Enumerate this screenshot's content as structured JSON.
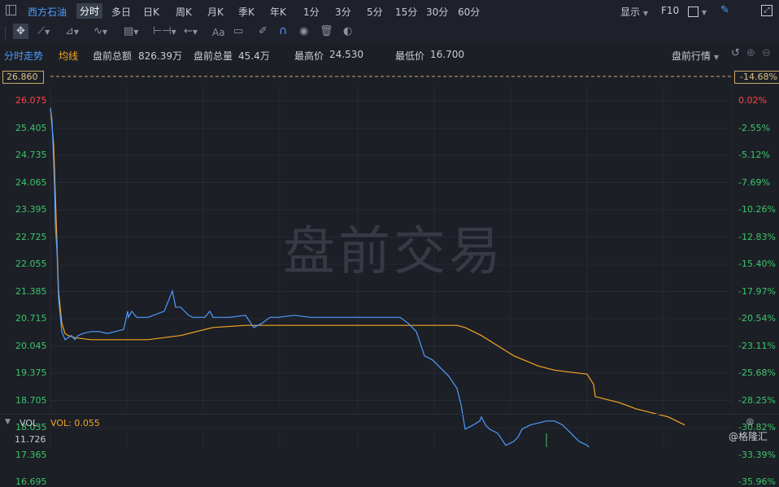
{
  "topbar": {
    "stock_name": "西方石油",
    "timeframes": [
      "分时",
      "多日",
      "日K",
      "周K",
      "月K",
      "季K",
      "年K",
      "1分",
      "3分",
      "5分",
      "15分",
      "30分",
      "60分"
    ],
    "active_timeframe": "分时",
    "display_label": "显示",
    "f10_label": "F10"
  },
  "toolbar": {
    "font_label": "Aa"
  },
  "info": {
    "mode_label": "分时走势",
    "avg_label": "均线",
    "amount_label": "盘前总额",
    "amount_value": "826.39万",
    "volume_label": "盘前总量",
    "volume_value": "45.4万",
    "high_label": "最高价",
    "high_value": "24.530",
    "low_label": "最低价",
    "low_value": "16.700",
    "session_label": "盘前行情"
  },
  "price_axis": {
    "top_price": "26.860",
    "top_pct": "-14.68%",
    "prices": [
      "26.075",
      "25.405",
      "24.735",
      "24.065",
      "23.395",
      "22.725",
      "22.055",
      "21.385",
      "20.715",
      "20.045",
      "19.375",
      "18.705",
      "18.035",
      "17.365",
      "16.695"
    ],
    "pcts": [
      "0.02%",
      "-2.55%",
      "-5.12%",
      "-7.69%",
      "-10.26%",
      "-12.83%",
      "-15.40%",
      "-17.97%",
      "-20.54%",
      "-23.11%",
      "-25.68%",
      "-28.25%",
      "-30.82%",
      "-33.39%",
      "-35.96%"
    ]
  },
  "watermark": "盘前交易",
  "volume": {
    "label": "VOL",
    "value_text": "VOL: 0.055",
    "axis_top": "11.726"
  },
  "brand": "@格隆汇",
  "colors": {
    "price_line": "#4d9cff",
    "avg_line": "#f5a623",
    "up": "#ff4545",
    "down": "#3bc66a",
    "accent": "#4d9cff"
  },
  "chart_data": {
    "type": "line",
    "ylim": [
      16.695,
      26.075
    ],
    "series": [
      {
        "name": "分时走势",
        "x": [
          0,
          2,
          4,
          5,
          6,
          8,
          10,
          14,
          18,
          22,
          26,
          30,
          34,
          40,
          50,
          60,
          70,
          80,
          90,
          95,
          96,
          100,
          106,
          110,
          120,
          140,
          150,
          154,
          160,
          170,
          175,
          180,
          190,
          196,
          200,
          220,
          240,
          250,
          260,
          270,
          280,
          300,
          320,
          340,
          360,
          380,
          400,
          420,
          430,
          440,
          450,
          460,
          470,
          480,
          490,
          500,
          505,
          510,
          520,
          528,
          530,
          535,
          540,
          550,
          560,
          570,
          575,
          580,
          590,
          600,
          610,
          620,
          630,
          640,
          650,
          660,
          670,
          680,
          690,
          700,
          710,
          715,
          720,
          730,
          740,
          750,
          760,
          766
        ],
        "y": [
          25.9,
          25.6,
          24.5,
          24.0,
          23.0,
          22.4,
          21.2,
          20.4,
          20.2,
          20.25,
          20.3,
          20.2,
          20.3,
          20.35,
          20.4,
          20.4,
          20.35,
          20.4,
          20.45,
          20.9,
          20.75,
          20.9,
          20.75,
          20.75,
          20.75,
          20.9,
          21.4,
          21.0,
          21.0,
          20.8,
          20.75,
          20.75,
          20.75,
          20.9,
          20.75,
          20.75,
          20.8,
          20.5,
          20.6,
          20.75,
          20.75,
          20.8,
          20.75,
          20.75,
          20.75,
          20.75,
          20.75,
          20.75,
          20.75,
          20.6,
          20.4,
          19.8,
          19.7,
          19.5,
          19.3,
          19.0,
          18.6,
          18.0,
          18.1,
          18.2,
          18.3,
          18.1,
          18.0,
          17.9,
          17.6,
          17.7,
          17.8,
          18.0,
          18.1,
          18.15,
          18.2,
          18.2,
          18.1,
          17.9,
          17.7,
          17.6,
          17.4,
          17.3,
          17.25,
          17.1,
          17.0,
          16.9,
          16.75,
          16.7,
          16.7,
          16.72,
          16.7,
          16.72
        ]
      },
      {
        "name": "均线",
        "x": [
          0,
          4,
          6,
          8,
          10,
          14,
          18,
          22,
          30,
          50,
          80,
          120,
          160,
          200,
          240,
          300,
          360,
          420,
          470,
          490,
          500,
          510,
          530,
          550,
          570,
          600,
          620,
          640,
          660,
          668,
          670,
          680,
          700,
          720,
          740,
          760,
          770,
          780
        ],
        "y": [
          25.9,
          25.0,
          23.8,
          22.6,
          21.4,
          20.6,
          20.35,
          20.3,
          20.25,
          20.2,
          20.2,
          20.2,
          20.3,
          20.5,
          20.55,
          20.55,
          20.55,
          20.55,
          20.55,
          20.55,
          20.55,
          20.5,
          20.3,
          20.05,
          19.8,
          19.55,
          19.45,
          19.4,
          19.35,
          19.1,
          18.8,
          18.75,
          18.65,
          18.5,
          18.4,
          18.3,
          18.2,
          18.1
        ]
      }
    ]
  }
}
